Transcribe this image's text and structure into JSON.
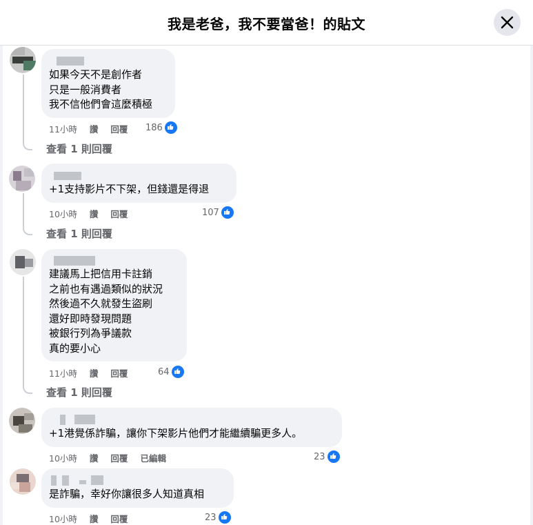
{
  "header": {
    "title": "我是老爸，我不要當爸！的貼文"
  },
  "comments": [
    {
      "text": "如果今天不是創作者\n只是一般消費者\n我不信他們會這麼積極",
      "time": "11小時",
      "like": "讚",
      "reply": "回覆",
      "reactions": "186",
      "view_replies": "查看 1 則回覆"
    },
    {
      "text": "+1支持影片不下架，但錢還是得退",
      "time": "10小時",
      "like": "讚",
      "reply": "回覆",
      "reactions": "107",
      "view_replies": "查看 1 則回覆"
    },
    {
      "text": "建議馬上把信用卡註銷\n之前也有遇過類似的狀況\n然後過不久就發生盜刷\n還好即時發現問題\n被銀行列為爭議款\n真的要小心",
      "time": "11小時",
      "like": "讚",
      "reply": "回覆",
      "reactions": "64",
      "view_replies": "查看 1 則回覆"
    },
    {
      "text": "+1港覺係詐騙，讓你下架影片他們才能繼續騙更多人。",
      "time": "10小時",
      "like": "讚",
      "reply": "回覆",
      "edited": "已編輯",
      "reactions": "23"
    },
    {
      "text": "是詐騙，幸好你讓很多人知道真相",
      "time": "10小時",
      "like": "讚",
      "reply": "回覆",
      "reactions": "23"
    }
  ],
  "colors": {
    "bubble": "#f0f2f5",
    "meta": "#65676b",
    "like_blue": "#1877f2",
    "thread_line": "#ccd0d5",
    "close_bg": "#e4e6eb"
  },
  "icons": {
    "close": "close-icon",
    "like": "like-thumb-icon"
  }
}
